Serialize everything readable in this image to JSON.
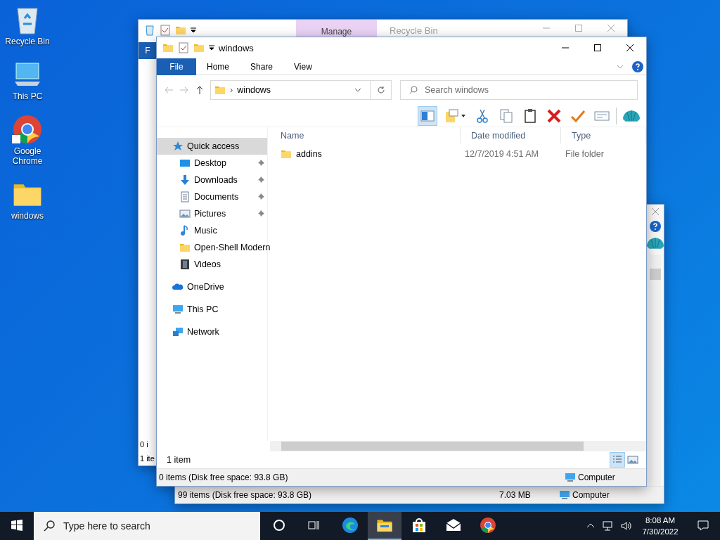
{
  "desktop_icons": [
    {
      "label": "Recycle Bin",
      "kind": "recycle"
    },
    {
      "label": "This PC",
      "kind": "pc"
    },
    {
      "label": "Google Chrome",
      "kind": "chrome"
    },
    {
      "label": "windows",
      "kind": "folder"
    }
  ],
  "back_window": {
    "context_tab": "Manage",
    "title": "Recycle Bin",
    "file_tab": "F",
    "left_texts": [
      "0 i",
      "1 ite"
    ]
  },
  "middle_window": {
    "status": "99 items (Disk free space: 93.8 GB)",
    "size": "7.03 MB",
    "location": "Computer"
  },
  "window": {
    "title": "windows",
    "file_tab": "File",
    "ribbon_tabs": [
      "Home",
      "Share",
      "View"
    ],
    "address_separator": "›",
    "address": "windows",
    "search_placeholder": "Search windows",
    "columns": [
      "Name",
      "Date modified",
      "Type"
    ],
    "rows": [
      {
        "name": "addins",
        "date": "12/7/2019 4:51 AM",
        "type": "File folder"
      }
    ],
    "nav": [
      {
        "label": "Quick access",
        "kind": "quick",
        "selected": true,
        "children": [
          {
            "label": "Desktop",
            "kind": "desktop",
            "selected": false,
            "pinned": true
          },
          {
            "label": "Downloads",
            "kind": "downloads",
            "selected": false,
            "pinned": true
          },
          {
            "label": "Documents",
            "kind": "documents",
            "selected": false,
            "pinned": true
          },
          {
            "label": "Pictures",
            "kind": "pictures",
            "selected": false,
            "pinned": true
          },
          {
            "label": "Music",
            "kind": "music",
            "selected": false,
            "pinned": false
          },
          {
            "label": "Open-Shell Modern",
            "kind": "folder",
            "selected": false,
            "pinned": false
          },
          {
            "label": "Videos",
            "kind": "videos",
            "selected": false,
            "pinned": false
          }
        ]
      },
      {
        "label": "OneDrive",
        "kind": "onedrive",
        "selected": false
      },
      {
        "label": "This PC",
        "kind": "pc",
        "selected": false
      },
      {
        "label": "Network",
        "kind": "network",
        "selected": false
      }
    ],
    "item_count": "1 item",
    "status": "0 items (Disk free space: 93.8 GB)",
    "location": "Computer"
  },
  "taskbar": {
    "search_placeholder": "Type here to search",
    "apps": [
      {
        "kind": "cortana",
        "active": false
      },
      {
        "kind": "taskview",
        "active": false
      },
      {
        "kind": "edge",
        "active": false
      },
      {
        "kind": "explorer",
        "active": true
      },
      {
        "kind": "store",
        "active": false
      },
      {
        "kind": "mail",
        "active": false
      },
      {
        "kind": "chrome",
        "active": false
      }
    ],
    "time": "8:08 AM",
    "date": "7/30/2022"
  }
}
